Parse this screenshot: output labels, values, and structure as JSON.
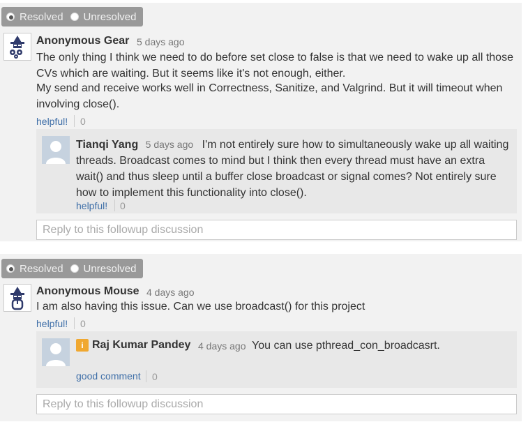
{
  "threads": [
    {
      "toggle": {
        "resolved_label": "Resolved",
        "unresolved_label": "Unresolved",
        "selected": "Resolved"
      },
      "post": {
        "author": "Anonymous Gear",
        "time": "5 days ago",
        "paragraphs": [
          "The only thing I think we need to do before set close to false is that we need to wake up all those CVs which are waiting. But it seems like it's not enough, either.",
          "My send and receive works well in Correctness, Sanitize, and Valgrind. But it will timeout when involving close()."
        ],
        "helpful_label": "helpful!",
        "helpful_count": "0",
        "avatar_icon": "anonymous-gear-icon"
      },
      "reply": {
        "author": "Tianqi Yang",
        "time": "5 days ago",
        "text": "I'm not entirely sure how to simultaneously wake up all waiting threads. Broadcast comes to mind but I think then every thread must have an extra wait() and thus sleep until a buffer close broadcast or signal comes? Not entirely sure how to implement this functionality into close().",
        "helpful_label": "helpful!",
        "helpful_count": "0",
        "avatar_icon": "person-icon"
      },
      "reply_placeholder": "Reply to this followup discussion"
    },
    {
      "toggle": {
        "resolved_label": "Resolved",
        "unresolved_label": "Unresolved",
        "selected": "Resolved"
      },
      "post": {
        "author": "Anonymous Mouse",
        "time": "4 days ago",
        "paragraphs": [
          "I am also having this issue. Can we use broadcast() for this project"
        ],
        "helpful_label": "helpful!",
        "helpful_count": "0",
        "avatar_icon": "anonymous-mouse-icon"
      },
      "reply": {
        "author": "Raj Kumar Pandey",
        "badge": "i",
        "time": "4 days ago",
        "text": "You can use pthread_con_broadcasrt.",
        "good_comment_label": "good comment",
        "good_comment_count": "0",
        "avatar_icon": "person-icon"
      },
      "reply_placeholder": "Reply to this followup discussion"
    }
  ],
  "colors": {
    "link": "#3f6fa8",
    "toggle_bg": "#999999",
    "thread_bg": "#f2f2f2",
    "reply_bg": "#e8e8e8",
    "instructor_badge": "#f0a830"
  }
}
